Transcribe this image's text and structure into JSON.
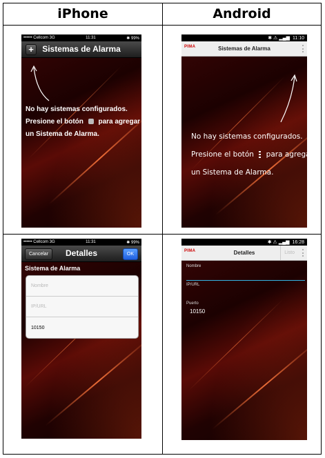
{
  "headers": {
    "left": "iPhone",
    "right": "Android"
  },
  "iphone_empty": {
    "status": {
      "carrier": "•••••• Cellcom  3G",
      "time": "11:31",
      "battery": "✱ 99%"
    },
    "title": "Sistemas de Alarma",
    "plus": "+",
    "message": [
      "No hay sistemas configurados.",
      "Presione el botón",
      "para agregar",
      "un Sistema de Alarma."
    ]
  },
  "android_empty": {
    "status": {
      "icons": "✱ ⚠ ▂▄▆",
      "time": "11:10"
    },
    "logo": "PIMA",
    "title": "Sistemas de Alarma",
    "message": [
      "No hay sistemas configurados.",
      "Presione el botón",
      "para agregar",
      "un Sistema de Alarma."
    ]
  },
  "iphone_details": {
    "status": {
      "carrier": "•••••• Cellcom  3G",
      "time": "11:31",
      "battery": "✱ 99%"
    },
    "cancel": "Cancelar",
    "title": "Detalles",
    "ok": "OK",
    "section": "Sistema de Alarma",
    "fields": {
      "name_placeholder": "Nombre",
      "ip_placeholder": "IP/URL",
      "port_value": "10150"
    }
  },
  "android_details": {
    "status": {
      "icons": "✱ ⚠ ▂▄▆",
      "time": "16:28"
    },
    "logo": "PIMA",
    "title": "Detalles",
    "done": "Listo",
    "fields": {
      "name_label": "Nombre",
      "ip_label": "IP/URL",
      "port_label": "Puerto",
      "port_value": "10150"
    }
  },
  "colors": {
    "ios_ok": "#1f5fe0",
    "android_accent": "#35b6e6",
    "bg_red": "#5a0b06"
  }
}
